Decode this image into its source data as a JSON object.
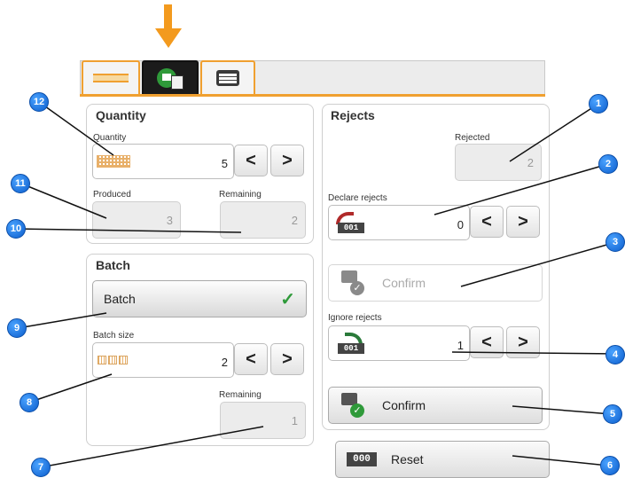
{
  "indicator_color": "#f39a1e",
  "tabs": [
    {
      "name": "settings-tab",
      "icon": "bars-icon"
    },
    {
      "name": "counter-tab",
      "icon": "arrow-document-icon",
      "active": true
    },
    {
      "name": "messages-tab",
      "icon": "message-icon"
    }
  ],
  "quantity": {
    "title": "Quantity",
    "quantity_label": "Quantity",
    "quantity_value": "5",
    "produced_label": "Produced",
    "produced_value": "3",
    "remaining_label": "Remaining",
    "remaining_value": "2",
    "prev": "<",
    "next": ">"
  },
  "batch": {
    "title": "Batch",
    "toggle_label": "Batch",
    "toggle_check": "✓",
    "size_label": "Batch size",
    "size_value": "2",
    "remaining_label": "Remaining",
    "remaining_value": "1",
    "prev": "<",
    "next": ">"
  },
  "rejects": {
    "title": "Rejects",
    "rejected_label": "Rejected",
    "rejected_value": "2",
    "declare_label": "Declare rejects",
    "declare_value": "0",
    "declare_counter": "001",
    "confirm_disabled_label": "Confirm",
    "ignore_label": "Ignore rejects",
    "ignore_value": "1",
    "ignore_counter": "001",
    "confirm_label": "Confirm",
    "prev": "<",
    "next": ">"
  },
  "reset": {
    "icon_text": "000",
    "label": "Reset"
  },
  "callouts": [
    "1",
    "2",
    "3",
    "4",
    "5",
    "6",
    "7",
    "8",
    "9",
    "10",
    "11",
    "12"
  ]
}
